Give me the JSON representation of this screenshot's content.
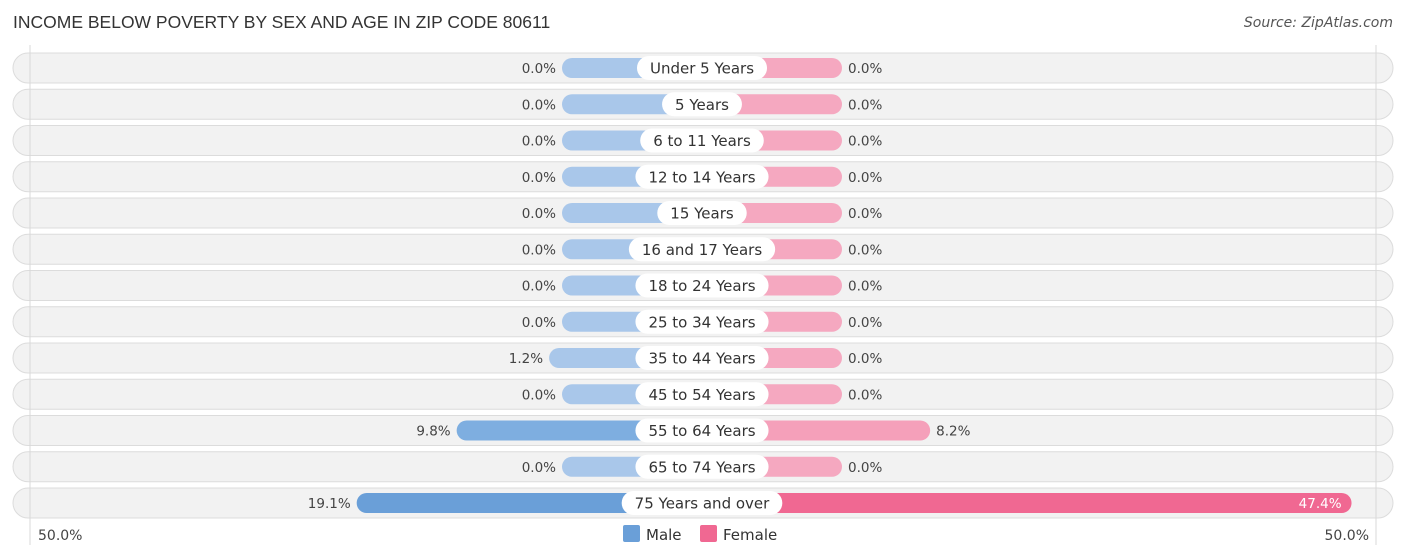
{
  "title": "INCOME BELOW POVERTY BY SEX AND AGE IN ZIP CODE 80611",
  "source": "Source: ZipAtlas.com",
  "colors": {
    "male": "#6a9fd8",
    "male_light": "#a9c7ea",
    "female": "#f06892",
    "female_light": "#f5a8c0",
    "row_bg": "#f2f2f2"
  },
  "chart_data": {
    "type": "bar",
    "orientation": "horizontal-diverging",
    "title": "INCOME BELOW POVERTY BY SEX AND AGE IN ZIP CODE 80611",
    "categories": [
      "Under 5 Years",
      "5 Years",
      "6 to 11 Years",
      "12 to 14 Years",
      "15 Years",
      "16 and 17 Years",
      "18 to 24 Years",
      "25 to 34 Years",
      "35 to 44 Years",
      "45 to 54 Years",
      "55 to 64 Years",
      "65 to 74 Years",
      "75 Years and over"
    ],
    "series": [
      {
        "name": "Male",
        "values": [
          0.0,
          0.0,
          0.0,
          0.0,
          0.0,
          0.0,
          0.0,
          0.0,
          1.2,
          0.0,
          9.8,
          0.0,
          19.1
        ],
        "labels": [
          "0.0%",
          "0.0%",
          "0.0%",
          "0.0%",
          "0.0%",
          "0.0%",
          "0.0%",
          "0.0%",
          "1.2%",
          "0.0%",
          "9.8%",
          "0.0%",
          "19.1%"
        ]
      },
      {
        "name": "Female",
        "values": [
          0.0,
          0.0,
          0.0,
          0.0,
          0.0,
          0.0,
          0.0,
          0.0,
          0.0,
          0.0,
          8.2,
          0.0,
          47.4
        ],
        "labels": [
          "0.0%",
          "0.0%",
          "0.0%",
          "0.0%",
          "0.0%",
          "0.0%",
          "0.0%",
          "0.0%",
          "0.0%",
          "0.0%",
          "8.2%",
          "0.0%",
          "47.4%"
        ]
      }
    ],
    "xlim": [
      -50,
      50
    ],
    "axis_left_label": "50.0%",
    "axis_right_label": "50.0%",
    "legend": {
      "position": "bottom-center",
      "entries": [
        "Male",
        "Female"
      ]
    },
    "units": "percent"
  }
}
